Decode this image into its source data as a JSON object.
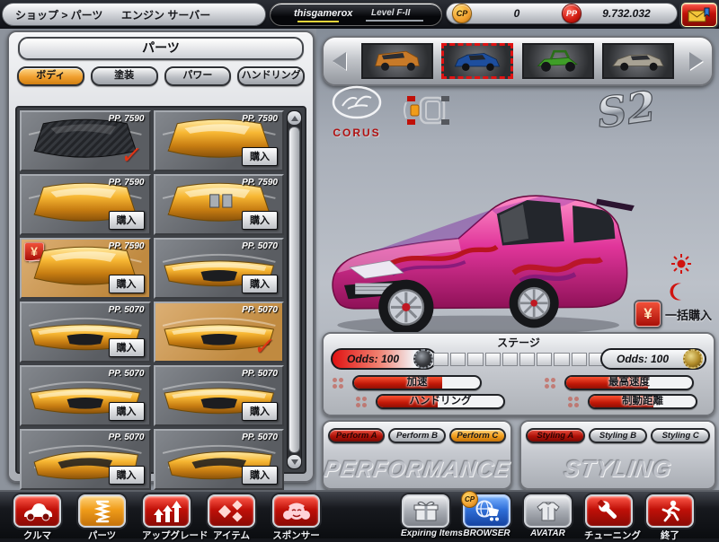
{
  "topbar": {
    "breadcrumb": "ショップ > パーツ",
    "server": "エンジン サーバー",
    "player_name": "thisgamerox",
    "player_level": "Level F-II",
    "cp_badge": "CP",
    "cp_value": "0",
    "pp_badge": "PP",
    "pp_value": "9.732.032"
  },
  "shop": {
    "title": "パーツ",
    "tabs": [
      {
        "label": "ボディ",
        "active": true
      },
      {
        "label": "塗装",
        "active": false
      },
      {
        "label": "パワー",
        "active": false
      },
      {
        "label": "ハンドリング",
        "active": false
      }
    ],
    "buy_label": "購入",
    "check_glyph": "✓",
    "yen_glyph": "¥",
    "items": [
      {
        "price": "PP. 7590",
        "kind": "carbon-hood",
        "status": "owned"
      },
      {
        "price": "PP. 7590",
        "kind": "gold-hood",
        "status": "for-sale"
      },
      {
        "price": "PP. 7590",
        "kind": "gold-hood",
        "status": "for-sale"
      },
      {
        "price": "PP. 7590",
        "kind": "vented-hood",
        "status": "for-sale"
      },
      {
        "price": "PP. 7590",
        "kind": "gold-hood",
        "status": "marked-for-purchase"
      },
      {
        "price": "PP. 5070",
        "kind": "front-bumper",
        "status": "for-sale"
      },
      {
        "price": "PP. 5070",
        "kind": "front-bumper",
        "status": "for-sale"
      },
      {
        "price": "PP. 5070",
        "kind": "front-bumper",
        "status": "equipped"
      },
      {
        "price": "PP. 5070",
        "kind": "front-bumper",
        "status": "for-sale"
      },
      {
        "price": "PP. 5070",
        "kind": "front-bumper",
        "status": "for-sale"
      },
      {
        "price": "PP. 5070",
        "kind": "front-bumper-angled",
        "status": "for-sale"
      },
      {
        "price": "PP. 5070",
        "kind": "front-bumper-angled",
        "status": "for-sale"
      }
    ]
  },
  "garage": {
    "cars": [
      {
        "name": "orange-van",
        "selected": false
      },
      {
        "name": "blue-hatchback",
        "selected": true
      },
      {
        "name": "green-buggy",
        "selected": false
      },
      {
        "name": "silver-sedan",
        "selected": false
      }
    ]
  },
  "viewport": {
    "brand_logo": "CORUS",
    "model_logo": "S2",
    "bulk_buy_label": "一括購入",
    "yen_glyph": "¥"
  },
  "stage": {
    "title": "ステージ",
    "odds_left": "Odds: 100",
    "odds_right": "Odds: 100",
    "segments_total": 10,
    "stats": [
      {
        "label": "加速",
        "value": 70
      },
      {
        "label": "最高速度",
        "value": 65
      },
      {
        "label": "ハンドリング",
        "value": 48
      },
      {
        "label": "制動距離",
        "value": 60
      }
    ]
  },
  "setup": {
    "perform_buttons": [
      "Perform A",
      "Perform B",
      "Perform C"
    ],
    "performance_watermark": "PERFORMANCE",
    "styling_buttons": [
      "Styling A",
      "Styling B",
      "Styling C"
    ],
    "styling_watermark": "STYLING"
  },
  "toolbar": {
    "items": [
      {
        "label": "クルマ",
        "active": false
      },
      {
        "label": "パーツ",
        "active": true
      },
      {
        "label": "アップグレード",
        "active": false
      },
      {
        "label": "アイテム",
        "active": false
      },
      {
        "label": "スポンサー",
        "active": false
      },
      {
        "label": "Expiring Items",
        "active": false
      },
      {
        "label": "BROWSER",
        "active": false
      },
      {
        "label": "AVATAR",
        "active": false
      },
      {
        "label": "チューニング",
        "active": false
      },
      {
        "label": "終了",
        "active": false
      }
    ]
  },
  "colors": {
    "accent_orange": "#f09f2e",
    "alert_red": "#c01008",
    "gold_part": "#f7b733",
    "car_pink": "#e0359a",
    "browser_blue": "#2f6fd8"
  }
}
